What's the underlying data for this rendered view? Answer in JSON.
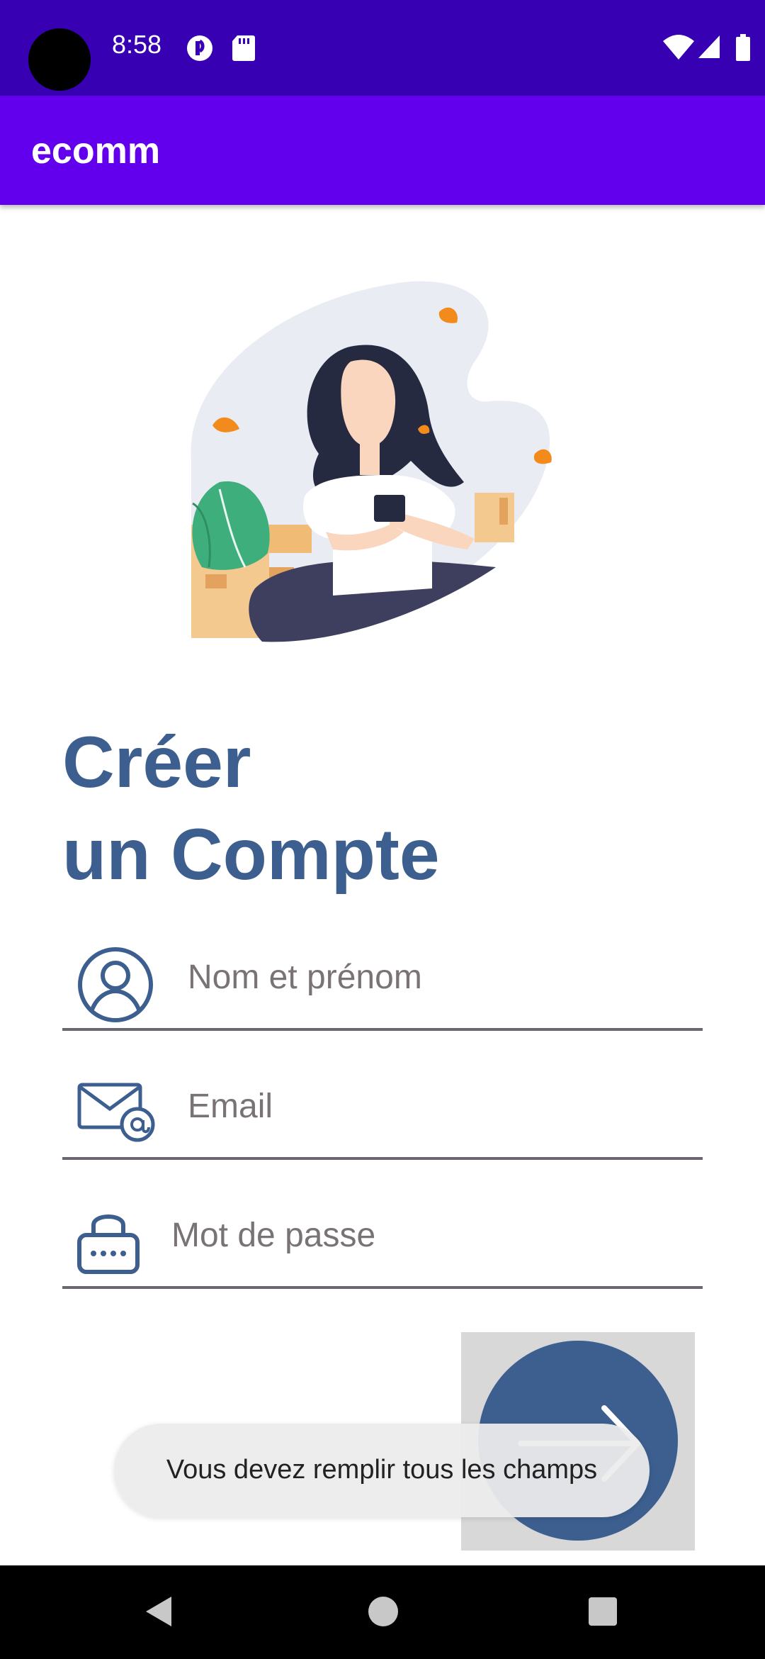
{
  "status_bar": {
    "time": "8:58",
    "left_icons": [
      "camera-cutout-icon",
      "data-saver-icon",
      "sd-card-icon"
    ],
    "right_icons": [
      "wifi-icon",
      "signal-icon",
      "battery-icon"
    ]
  },
  "app_bar": {
    "title": "ecomm"
  },
  "heading": {
    "line1": "Créer",
    "line2": "un Compte"
  },
  "form": {
    "name_field": {
      "placeholder": "Nom et prénom",
      "value": "",
      "icon": "user-icon"
    },
    "email_field": {
      "placeholder": "Email",
      "value": "",
      "icon": "email-icon"
    },
    "password_field": {
      "placeholder": "Mot de passe",
      "value": "",
      "icon": "lock-icon"
    },
    "submit_icon": "arrow-right-icon"
  },
  "toast": {
    "message": "Vous devez remplir tous les champs"
  },
  "nav_bar": {
    "buttons": [
      "back-icon",
      "home-icon",
      "recents-icon"
    ]
  },
  "colors": {
    "status_bar": "#3700b3",
    "app_bar": "#6200ee",
    "accent": "#3d5f8f",
    "field_underline": "#6b6670"
  }
}
